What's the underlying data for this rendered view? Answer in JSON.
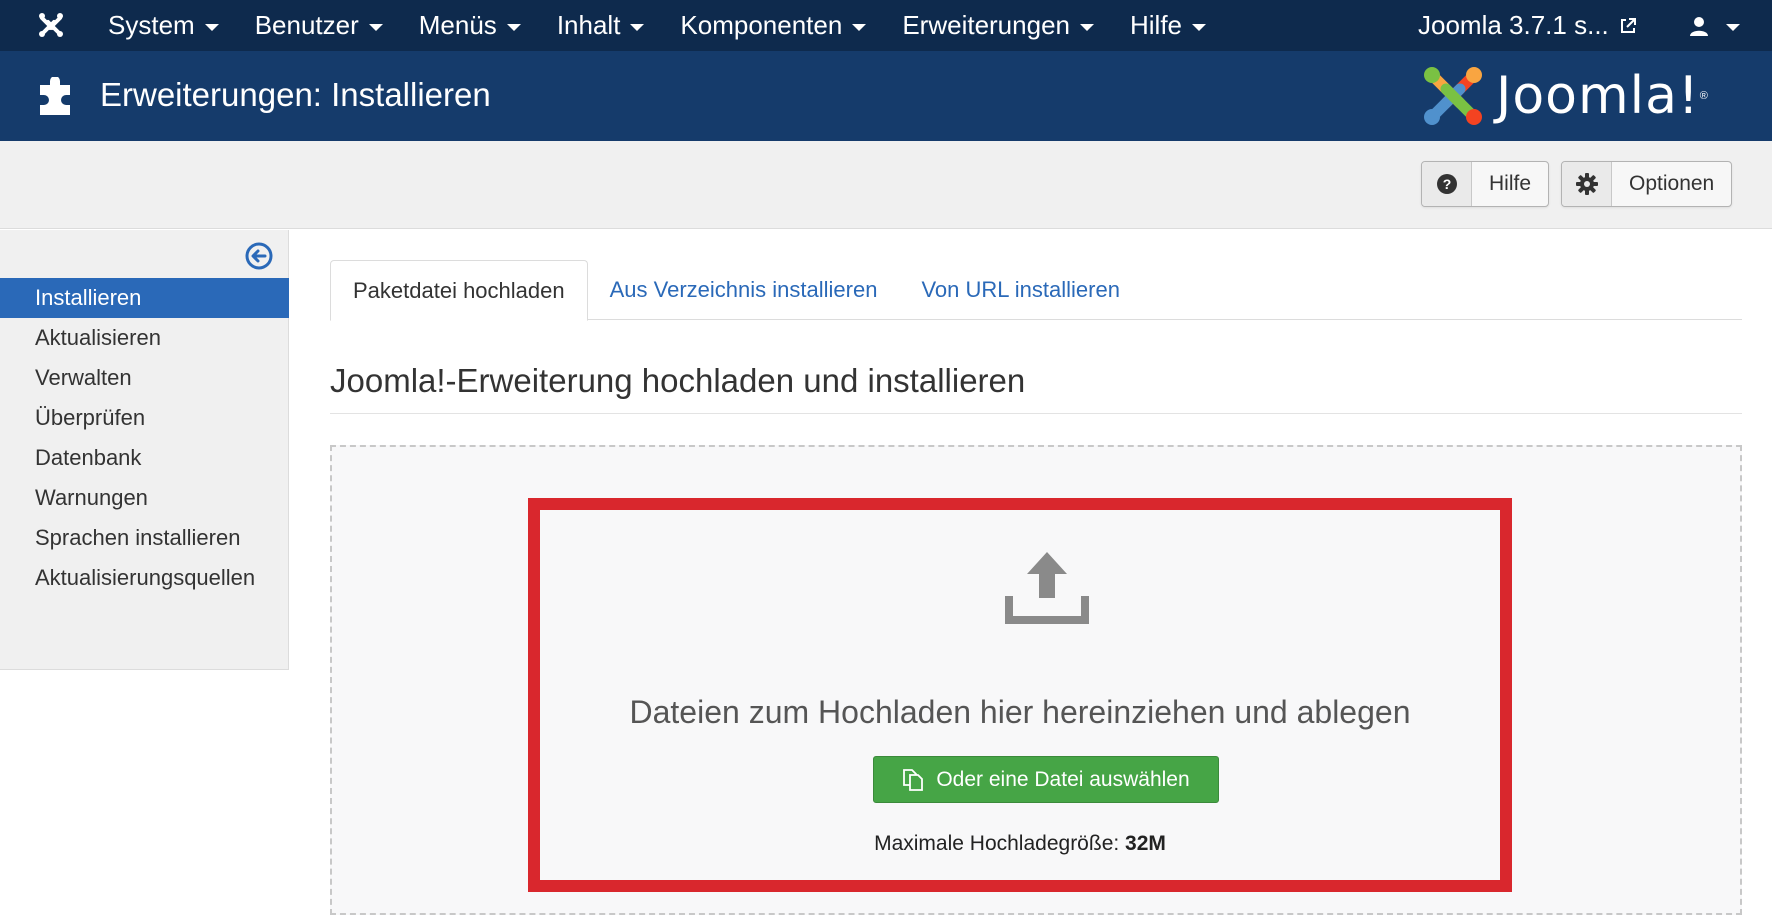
{
  "navbar": {
    "brand_icon": "joomla-icon",
    "menu": [
      {
        "label": "System"
      },
      {
        "label": "Benutzer"
      },
      {
        "label": "Menüs"
      },
      {
        "label": "Inhalt"
      },
      {
        "label": "Komponenten"
      },
      {
        "label": "Erweiterungen"
      },
      {
        "label": "Hilfe"
      }
    ],
    "site_link": "Joomla 3.7.1 s...",
    "user_icon": "user-icon"
  },
  "header": {
    "title": "Erweiterungen: Installieren",
    "logo_text": "Joomla!",
    "logo_reg": "®"
  },
  "toolbar": {
    "help_label": "Hilfe",
    "options_label": "Optionen"
  },
  "sidebar": {
    "items": [
      {
        "label": "Installieren",
        "active": true
      },
      {
        "label": "Aktualisieren"
      },
      {
        "label": "Verwalten"
      },
      {
        "label": "Überprüfen"
      },
      {
        "label": "Datenbank"
      },
      {
        "label": "Warnungen"
      },
      {
        "label": "Sprachen installieren"
      },
      {
        "label": "Aktualisierungsquellen"
      }
    ]
  },
  "tabs": [
    {
      "label": "Paketdatei hochladen",
      "active": true
    },
    {
      "label": "Aus Verzeichnis installieren"
    },
    {
      "label": "Von URL installieren"
    }
  ],
  "main": {
    "section_title": "Joomla!-Erweiterung hochladen und installieren",
    "drop_text": "Dateien zum Hochladen hier hereinziehen und ablegen",
    "select_button": "Oder eine Datei auswählen",
    "max_size_label": "Maximale Hochladegröße:",
    "max_size_value": "32M"
  },
  "colors": {
    "navbar": "#0e2a4d",
    "header": "#153b6b",
    "accent": "#2a69b8",
    "success": "#46a546",
    "highlight": "#d9272d"
  }
}
